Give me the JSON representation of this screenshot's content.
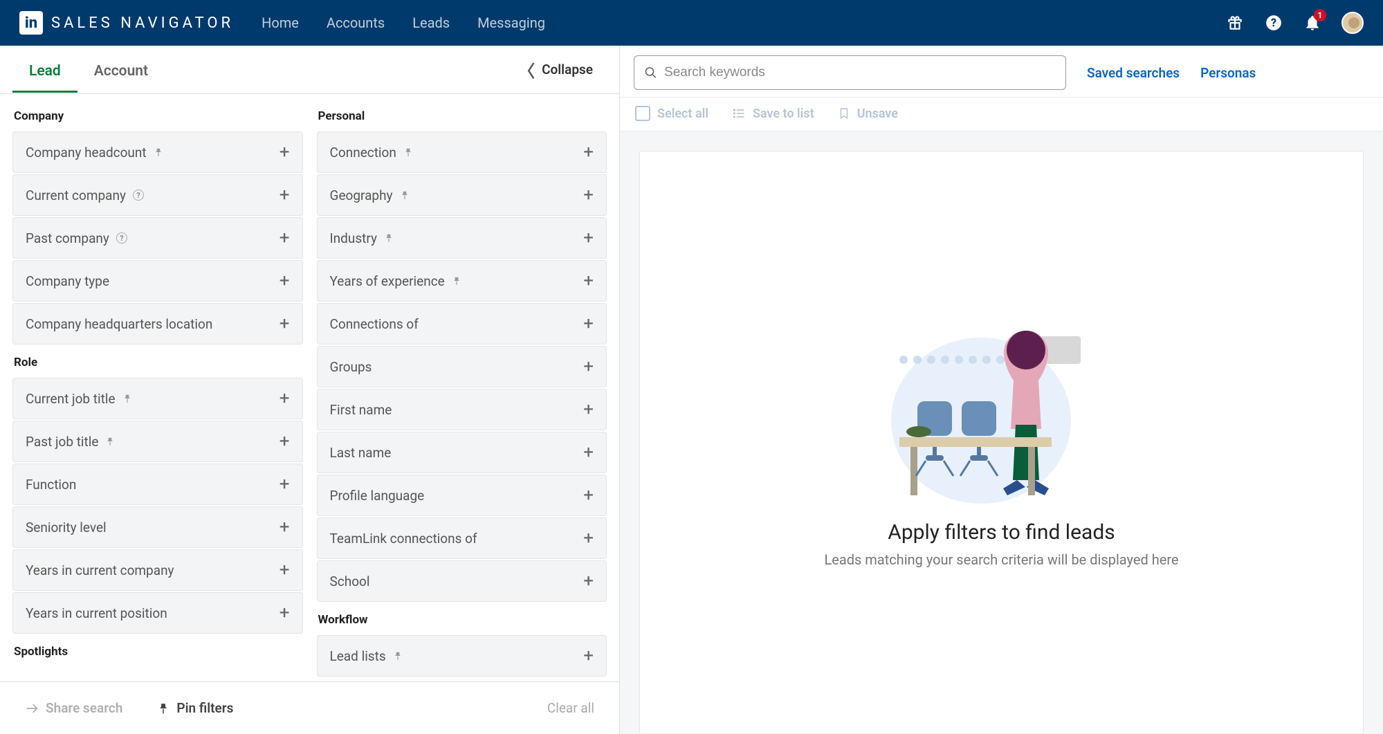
{
  "brand": "SALES NAVIGATOR",
  "nav": {
    "items": [
      "Home",
      "Accounts",
      "Leads",
      "Messaging"
    ]
  },
  "notifications": {
    "count": "1"
  },
  "tabs": {
    "lead": "Lead",
    "account": "Account",
    "collapse": "Collapse"
  },
  "sections": {
    "company": {
      "title": "Company",
      "items": [
        {
          "label": "Company headcount",
          "pin": true
        },
        {
          "label": "Current company",
          "help": true
        },
        {
          "label": "Past company",
          "help": true
        },
        {
          "label": "Company type"
        },
        {
          "label": "Company headquarters location"
        }
      ]
    },
    "role": {
      "title": "Role",
      "items": [
        {
          "label": "Current job title",
          "pin": true
        },
        {
          "label": "Past job title",
          "pin": true
        },
        {
          "label": "Function"
        },
        {
          "label": "Seniority level"
        },
        {
          "label": "Years in current company"
        },
        {
          "label": "Years in current position"
        }
      ]
    },
    "spotlights": {
      "title": "Spotlights"
    },
    "personal": {
      "title": "Personal",
      "items": [
        {
          "label": "Connection",
          "pin": true
        },
        {
          "label": "Geography",
          "pin": true
        },
        {
          "label": "Industry",
          "pin": true
        },
        {
          "label": "Years of experience",
          "pin": true
        },
        {
          "label": "Connections of"
        },
        {
          "label": "Groups"
        },
        {
          "label": "First name"
        },
        {
          "label": "Last name"
        },
        {
          "label": "Profile language"
        },
        {
          "label": "TeamLink connections of"
        },
        {
          "label": "School"
        }
      ]
    },
    "workflow": {
      "title": "Workflow",
      "items": [
        {
          "label": "Lead lists",
          "pin": true
        }
      ]
    }
  },
  "footer": {
    "share": "Share search",
    "pin": "Pin filters",
    "clear": "Clear all"
  },
  "search": {
    "placeholder": "Search keywords",
    "saved": "Saved searches",
    "personas": "Personas"
  },
  "actions": {
    "select_all": "Select all",
    "save_to_list": "Save to list",
    "unsave": "Unsave"
  },
  "empty": {
    "title": "Apply filters to find leads",
    "sub": "Leads matching your search criteria will be displayed here"
  }
}
